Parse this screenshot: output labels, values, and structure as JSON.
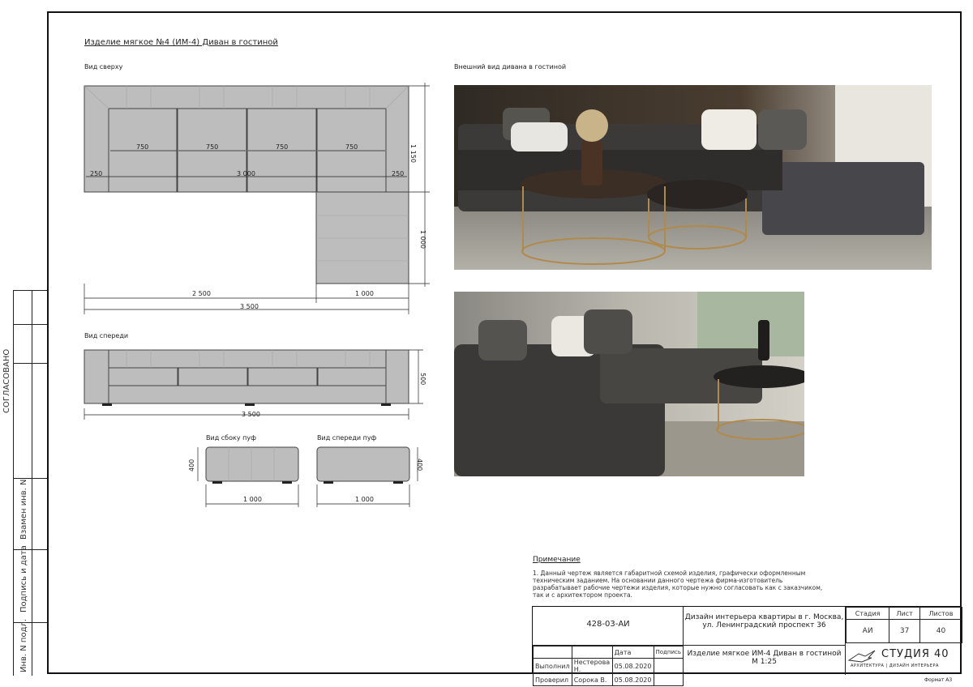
{
  "sheet": {
    "title": "Изделие мягкое №4 (ИМ-4) Диван в гостиной",
    "format": "Формат А3"
  },
  "views": {
    "top": "Вид сверху",
    "front": "Вид спереди",
    "pouf_side": "Вид сбоку пуф",
    "pouf_front": "Вид спереди пуф",
    "exterior": "Внешний вид дивана в гостиной"
  },
  "dims": {
    "seat1": "750",
    "seat2": "750",
    "seat3": "750",
    "seat4": "750",
    "arm_left": "250",
    "arm_right": "250",
    "inner_len": "3 000",
    "depth": "1 150",
    "ottoman_depth": "1 000",
    "bottom_left": "2 500",
    "bottom_right": "1 000",
    "total": "3 500",
    "front_total": "3 500",
    "front_height": "500",
    "pouf_side_h": "400",
    "pouf_side_w": "1 000",
    "pouf_front_h": "400",
    "pouf_front_w": "1 000"
  },
  "side_margin": {
    "approved": "СОГЛАСОВАНО",
    "inv_no": "Взамен инв. N",
    "sign_date": "Подпись и дата",
    "inv_orig": "Инв. N подл."
  },
  "note": {
    "heading": "Примечание",
    "lines": [
      "1. Данный чертеж является габаритной схемой изделия, графически оформленным",
      "техническим заданием. На основании данного чертежа фирма-изготовитель",
      "разрабатывает рабочие чертежи изделия, которые нужно согласовать как с заказчиком,",
      "так и с архитектором проекта."
    ]
  },
  "stamp": {
    "code": "428-03-АИ",
    "project_l1": "Дизайн интерьера квартиры в г. Москва,",
    "project_l2": "ул. Ленинградский проспект 36",
    "sheet_title_l1": "Изделие мягкое ИМ-4 Диван в гостиной",
    "sheet_title_l2": "М 1:25",
    "h_stage": "Стадия",
    "h_sheet": "Лист",
    "h_sheets": "Листов",
    "stage": "АИ",
    "sheet_no": "37",
    "sheets": "40",
    "h_date": "Дата",
    "h_sign": "Подпись",
    "row1_role": "Выполнил",
    "row1_name": "Нестерова Н.",
    "row1_date": "05.08.2020",
    "row2_role": "Проверил",
    "row2_name": "Сорока В.",
    "row2_date": "05.08.2020",
    "studio_name": "СТУДИЯ 40",
    "studio_sub": "АРХИТЕКТУРА | ДИЗАЙН ИНТЕРЬЕРА"
  }
}
